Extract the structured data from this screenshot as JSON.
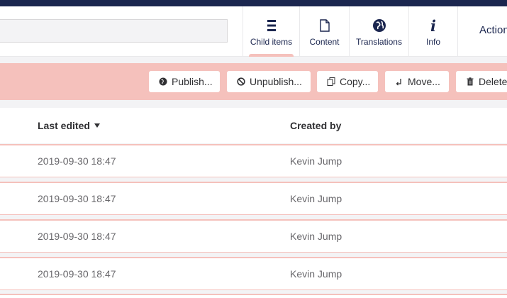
{
  "header": {
    "name_value": "",
    "apps": [
      {
        "label": "Child items",
        "icon": "list-icon",
        "active": true
      },
      {
        "label": "Content",
        "icon": "document-icon",
        "active": false
      },
      {
        "label": "Translations",
        "icon": "globe-icon",
        "active": false
      },
      {
        "label": "Info",
        "icon": "info-icon",
        "active": false
      }
    ],
    "actions_label": "Actions"
  },
  "toolbar": {
    "publish": "Publish...",
    "unpublish": "Unpublish...",
    "copy": "Copy...",
    "move": "Move...",
    "delete": "Delete"
  },
  "table": {
    "columns": [
      "Last edited",
      "Created by"
    ],
    "rows": [
      {
        "last_edited": "2019-09-30 18:47",
        "created_by": "Kevin Jump"
      },
      {
        "last_edited": "2019-09-30 18:47",
        "created_by": "Kevin Jump"
      },
      {
        "last_edited": "2019-09-30 18:47",
        "created_by": "Kevin Jump"
      },
      {
        "last_edited": "2019-09-30 18:47",
        "created_by": "Kevin Jump"
      }
    ]
  },
  "colors": {
    "navy": "#1b264f",
    "pink": "#f5c1bc",
    "text": "#303033",
    "muted": "#68676b"
  }
}
